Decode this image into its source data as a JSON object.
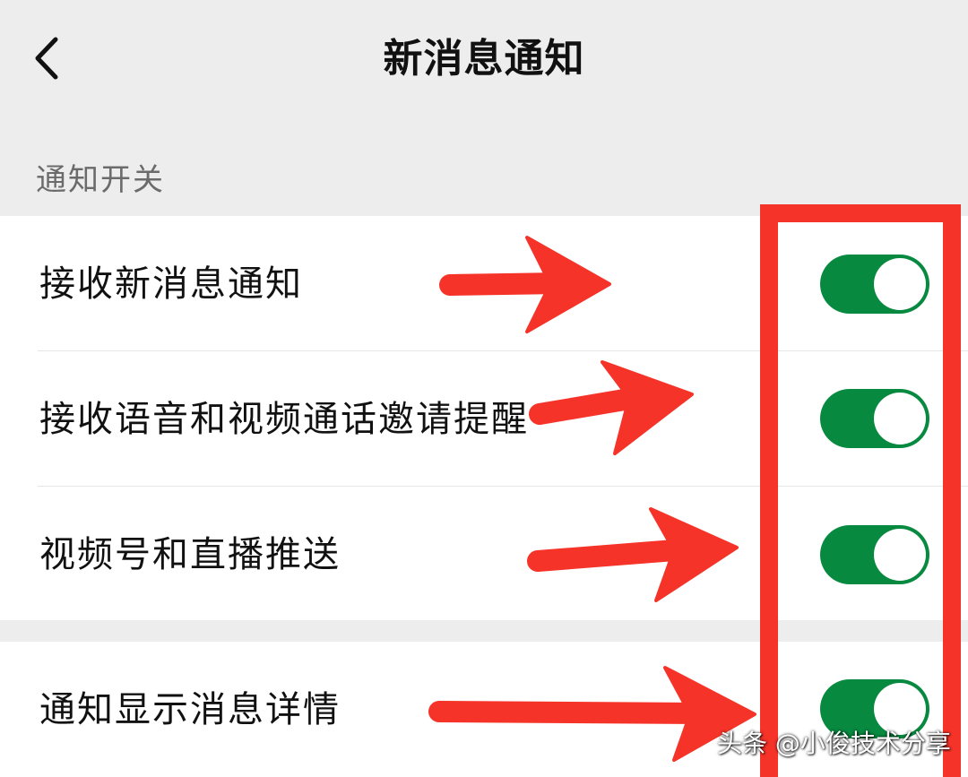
{
  "header": {
    "back_icon": "chevron-left-icon",
    "title": "新消息通知"
  },
  "section": {
    "label": "通知开关"
  },
  "settings": [
    {
      "label": "接收新消息通知",
      "enabled": true
    },
    {
      "label": "接收语音和视频通话邀请提醒",
      "enabled": true
    },
    {
      "label": "视频号和直播推送",
      "enabled": true
    },
    {
      "label": "通知显示消息详情",
      "enabled": true
    }
  ],
  "colors": {
    "background": "#ededed",
    "surface": "#ffffff",
    "toggle_on": "#07893f",
    "annotation": "#f53328"
  },
  "watermark": {
    "text": "头条 @小俊技术分享"
  }
}
